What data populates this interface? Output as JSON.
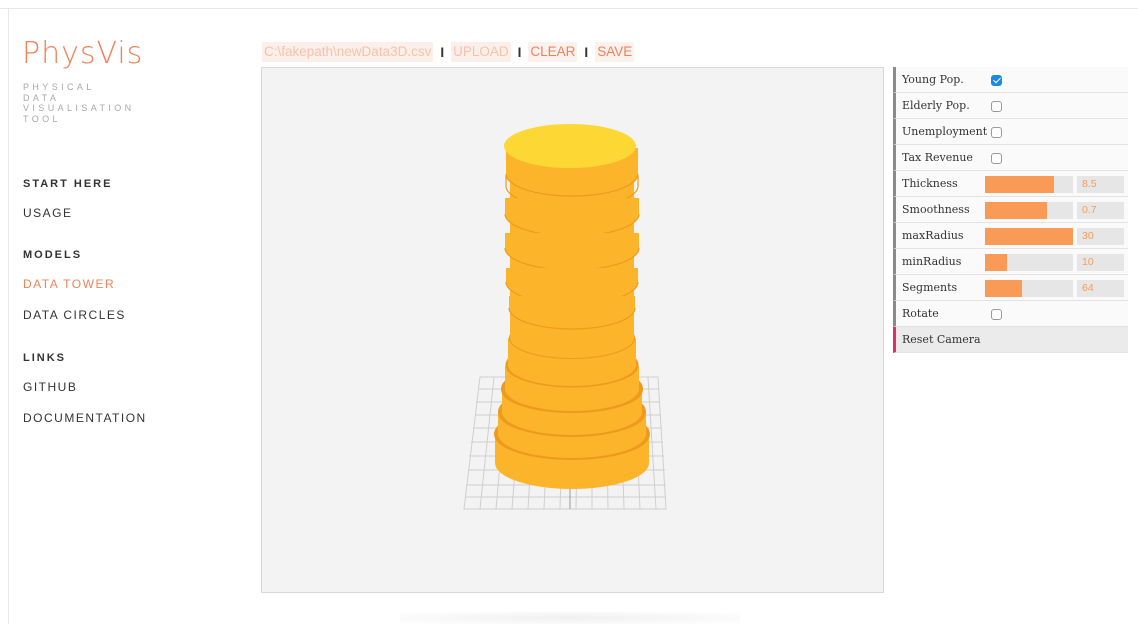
{
  "app": {
    "logo": "PhysVis",
    "subtitle": [
      "PHYSICAL",
      "DATA",
      "VISUALISATION",
      "TOOL"
    ]
  },
  "nav": {
    "start_heading": "START HERE",
    "usage": "USAGE",
    "models_heading": "MODELS",
    "data_tower": "DATA TOWER",
    "data_circles": "DATA CIRCLES",
    "links_heading": "LINKS",
    "github": "GITHUB",
    "documentation": "DOCUMENTATION",
    "active_item": "DATA TOWER"
  },
  "toolbar": {
    "file_path": "C:\\fakepath\\newData3D.csv",
    "separator": "I",
    "upload_label": "UPLOAD",
    "clear_label": "CLEAR",
    "save_label": "SAVE"
  },
  "controls": {
    "young_pop": {
      "label": "Young Pop.",
      "checked": true
    },
    "elderly_pop": {
      "label": "Elderly Pop.",
      "checked": false
    },
    "unemployment": {
      "label": "Unemployment",
      "checked": false
    },
    "tax_revenue": {
      "label": "Tax Revenue",
      "checked": false
    },
    "thickness": {
      "label": "Thickness",
      "value": "8.5",
      "fill": 0.78
    },
    "smoothness": {
      "label": "Smoothness",
      "value": "0.7",
      "fill": 0.7
    },
    "max_radius": {
      "label": "maxRadius",
      "value": "30",
      "fill": 1.0
    },
    "min_radius": {
      "label": "minRadius",
      "value": "10",
      "fill": 0.25
    },
    "segments": {
      "label": "Segments",
      "value": "64",
      "fill": 0.42
    },
    "rotate": {
      "label": "Rotate",
      "checked": false
    },
    "reset_camera": {
      "label": "Reset Camera"
    }
  },
  "colors": {
    "accent": "#f0825a",
    "slider": "#f99a56",
    "tower_body": "#fcb42a",
    "tower_top": "#fdd835",
    "tower_ring": "#ee9a1e",
    "checkbox_checked": "#1e88e5",
    "reset_marker": "#e0306a"
  }
}
